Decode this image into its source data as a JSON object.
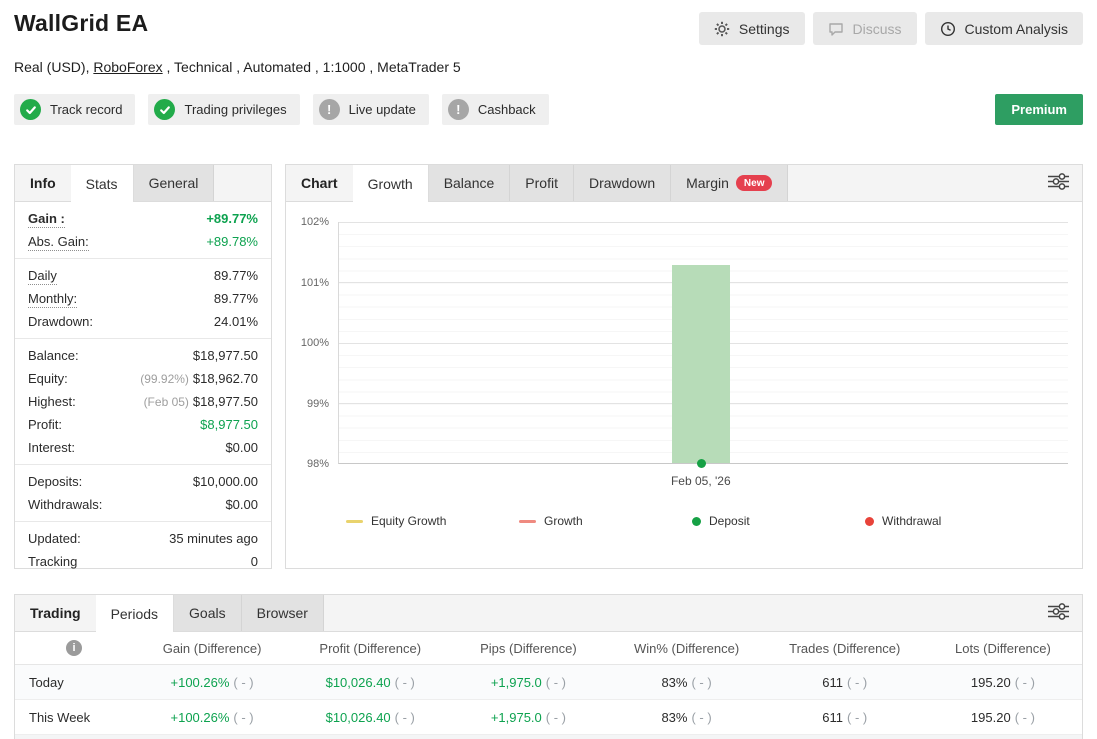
{
  "colors": {
    "positive_green": "#0da24f",
    "bar_green": "#b7dcb8",
    "deposit_green": "#16a145",
    "withdrawal_red": "#e8433a",
    "equity_growth_yellow": "#e9d36d",
    "growth_line_red": "#ef8a80",
    "premium_green": "#2e9e62",
    "badge_check_green": "#22ab4a",
    "badge_warn_gray": "#a6a6a6",
    "new_pill_red": "#e5404e"
  },
  "header": {
    "title": "WallGrid EA",
    "subtitle_prefix": "Real (USD), ",
    "broker_link": "RoboForex",
    "subtitle_suffix": " , Technical , Automated , 1:1000 , MetaTrader 5",
    "buttons": {
      "settings": "Settings",
      "discuss": "Discuss",
      "custom_analysis": "Custom Analysis"
    },
    "badges": [
      {
        "label": "Track record",
        "status": "ok"
      },
      {
        "label": "Trading privileges",
        "status": "ok"
      },
      {
        "label": "Live update",
        "status": "warn"
      },
      {
        "label": "Cashback",
        "status": "warn"
      }
    ],
    "premium_label": "Premium"
  },
  "info_panel": {
    "tabs": {
      "first": "Info",
      "active": "Stats",
      "third": "General"
    },
    "gain": {
      "label": "Gain :",
      "value": "+89.77%"
    },
    "abs_gain": {
      "label": "Abs. Gain:",
      "value": "+89.78%"
    },
    "daily": {
      "label": "Daily",
      "value": "89.77%"
    },
    "monthly": {
      "label": "Monthly:",
      "value": "89.77%"
    },
    "drawdown": {
      "label": "Drawdown:",
      "value": "24.01%"
    },
    "balance": {
      "label": "Balance:",
      "value": "$18,977.50"
    },
    "equity": {
      "label": "Equity:",
      "prefix": "(99.92%)",
      "value": "$18,962.70"
    },
    "highest": {
      "label": "Highest:",
      "prefix": "(Feb 05)",
      "value": "$18,977.50"
    },
    "profit": {
      "label": "Profit:",
      "value": "$8,977.50"
    },
    "interest": {
      "label": "Interest:",
      "value": "$0.00"
    },
    "deposits": {
      "label": "Deposits:",
      "value": "$10,000.00"
    },
    "withdrawals": {
      "label": "Withdrawals:",
      "value": "$0.00"
    },
    "updated": {
      "label": "Updated:",
      "value": "35 minutes ago"
    },
    "tracking": {
      "label": "Tracking",
      "value": "0"
    }
  },
  "chart_panel": {
    "tabs": {
      "first": "Chart",
      "active": "Growth",
      "t3": "Balance",
      "t4": "Profit",
      "t5": "Drawdown",
      "t6": "Margin"
    },
    "new_badge": "New",
    "yticks": [
      "102%",
      "101%",
      "100%",
      "99%",
      "98%"
    ],
    "xlabel": "Feb 05, '26",
    "legend": [
      {
        "label": "Equity Growth"
      },
      {
        "label": "Growth"
      },
      {
        "label": "Deposit"
      },
      {
        "label": "Withdrawal"
      }
    ]
  },
  "chart_data": {
    "type": "bar",
    "title": "Growth",
    "x": [
      "Feb 05, '26"
    ],
    "ylim": [
      98,
      102
    ],
    "ytick_labels": [
      "98%",
      "99%",
      "100%",
      "101%",
      "102%"
    ],
    "grid": true,
    "legend_position": "bottom",
    "series": [
      {
        "name": "Growth",
        "type": "column",
        "low": 98.0,
        "high": 101.3,
        "color": "#b7dcb8"
      },
      {
        "name": "Deposit",
        "type": "scatter",
        "y": [
          98.0
        ],
        "color": "#16a145"
      },
      {
        "name": "Equity Growth",
        "type": "line",
        "values": [],
        "color": "#e9d36d"
      },
      {
        "name": "Withdrawal",
        "type": "scatter",
        "y": [],
        "color": "#e8433a"
      }
    ]
  },
  "periods_panel": {
    "tabs": {
      "first": "Trading",
      "active": "Periods",
      "t3": "Goals",
      "t4": "Browser"
    },
    "columns": {
      "gain": "Gain (Difference)",
      "profit": "Profit (Difference)",
      "pips": "Pips (Difference)",
      "win": "Win% (Difference)",
      "trades": "Trades (Difference)",
      "lots": "Lots (Difference)"
    },
    "diff_placeholder": "( - )",
    "rows": [
      {
        "label": "Today",
        "gain": "+100.26%",
        "profit": "$10,026.40",
        "pips": "+1,975.0",
        "win": "83%",
        "trades": "611",
        "lots": "195.20"
      },
      {
        "label": "This Week",
        "gain": "+100.26%",
        "profit": "$10,026.40",
        "pips": "+1,975.0",
        "win": "83%",
        "trades": "611",
        "lots": "195.20"
      }
    ]
  },
  "icons": {
    "info_glyph": "i",
    "warn_glyph": "!"
  }
}
